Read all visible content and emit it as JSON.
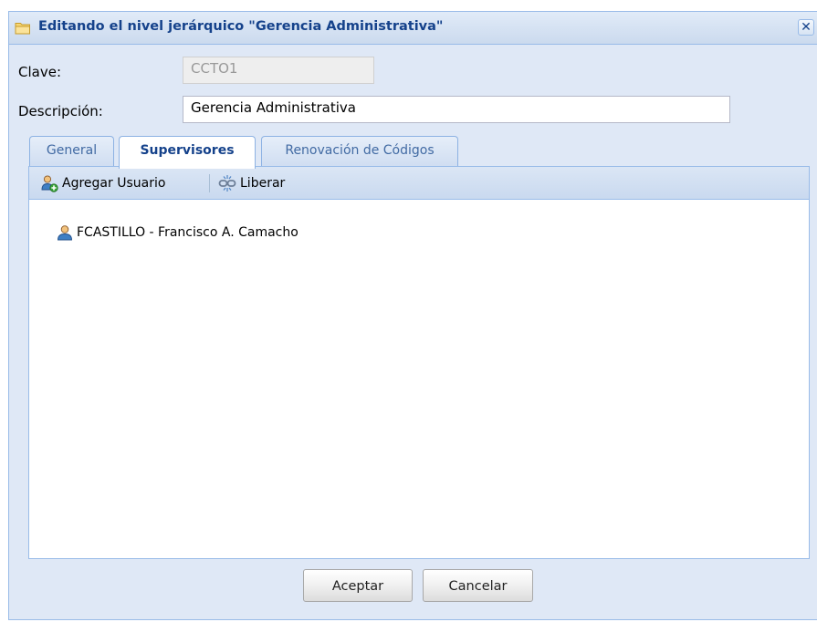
{
  "window": {
    "title": "Editando el nivel jerárquico \"Gerencia Administrativa\"",
    "close_glyph": "✕"
  },
  "form": {
    "clave_label": "Clave:",
    "clave_value": "CCTO1",
    "descripcion_label": "Descripción:",
    "descripcion_value": "Gerencia Administrativa"
  },
  "tabs": [
    {
      "label": "General",
      "active": false
    },
    {
      "label": "Supervisores",
      "active": true
    },
    {
      "label": "Renovación de Códigos",
      "active": false
    }
  ],
  "toolbar": {
    "add_user_label": "Agregar Usuario",
    "release_label": "Liberar"
  },
  "supervisors": [
    {
      "text": "FCASTILLO - Francisco A. Camacho"
    }
  ],
  "footer": {
    "accept_label": "Aceptar",
    "cancel_label": "Cancelar"
  },
  "icons": {
    "title": "folder-icon",
    "add_user": "add-user-icon",
    "release": "release-link-icon",
    "row": "user-icon"
  }
}
